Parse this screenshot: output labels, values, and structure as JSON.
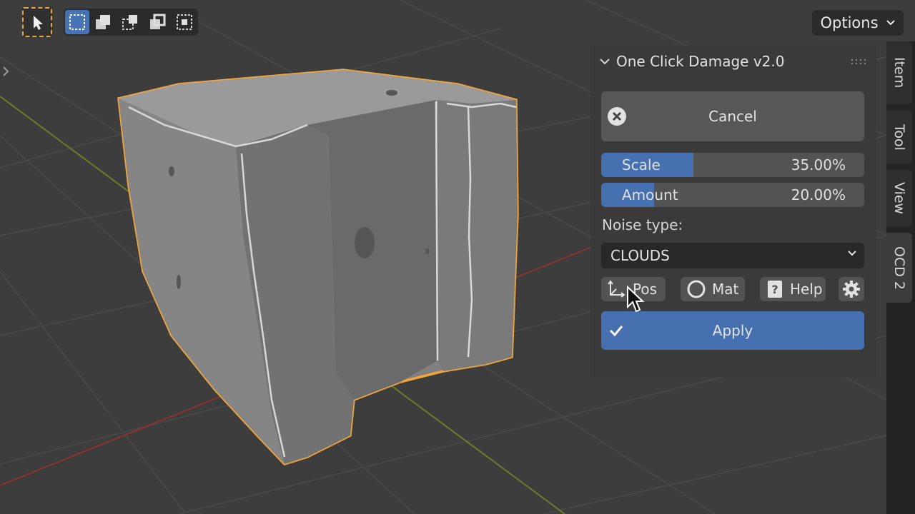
{
  "toolbar": {
    "select_tool_icon": "cursor-arrow-icon",
    "mode_icons": [
      "select-box-icon",
      "select-extend-icon",
      "select-subtract-icon",
      "select-difference-icon",
      "select-intersect-icon"
    ],
    "options_label": "Options"
  },
  "panel": {
    "title": "One Click Damage v2.0",
    "cancel_label": "Cancel",
    "scale": {
      "label": "Scale",
      "value": "35.00%",
      "fraction": 0.35
    },
    "amount": {
      "label": "Amount",
      "value": "20.00%",
      "fraction": 0.2
    },
    "noise_type_label": "Noise type:",
    "noise_type_value": "CLOUDS",
    "pos_label": "Pos",
    "mat_label": "Mat",
    "help_label": "Help",
    "apply_label": "Apply"
  },
  "side_tabs": [
    "Item",
    "Tool",
    "View",
    "OCD 2"
  ],
  "colors": {
    "accent": "#4772b3",
    "selection_outline": "#f0a63c",
    "background": "#3d3d3d",
    "panel": "#3a3a3a"
  }
}
